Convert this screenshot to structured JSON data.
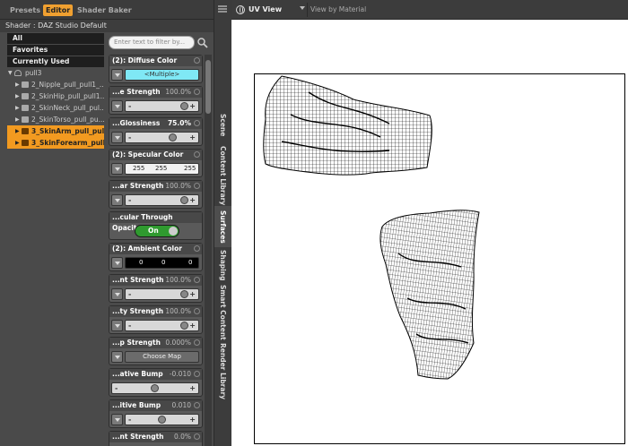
{
  "tabs": {
    "presets": "Presets",
    "editor": "Editor",
    "shader_baker": "Shader Baker"
  },
  "shader_label": "Shader : DAZ Studio Default",
  "categories": [
    "All",
    "Favorites",
    "Currently Used"
  ],
  "tree": {
    "root": "pull3",
    "items": [
      {
        "label": "2_Nipple_pull_pull1_...",
        "selected": false
      },
      {
        "label": "2_SkinHip_pull_pull1...",
        "selected": false
      },
      {
        "label": "2_SkinNeck_pull_pul...",
        "selected": false
      },
      {
        "label": "2_SkinTorso_pull_pu...",
        "selected": false
      },
      {
        "label": "3_SkinArm_pull_pull...",
        "selected": true
      },
      {
        "label": "3_SkinForearm_pull...",
        "selected": true
      }
    ]
  },
  "filter_placeholder": "Enter text to filter by...",
  "properties": {
    "diffuse_color": {
      "title": "(2): Diffuse Color",
      "value": "<Multiple>"
    },
    "diffuse_strength": {
      "title": "...e Strength",
      "value": "100.0%",
      "level": 1.0
    },
    "glossiness": {
      "title": "...Glossiness",
      "value": "75.0%",
      "level": 0.75
    },
    "specular_color": {
      "title": "(2): Specular Color",
      "r": "255",
      "g": "255",
      "b": "255"
    },
    "specular_strength": {
      "title": "...ar Strength",
      "value": "100.0%",
      "level": 1.0
    },
    "through_opacity": {
      "title": "...cular Through Opacity",
      "state": "On"
    },
    "ambient_color": {
      "title": "(2): Ambient Color",
      "r": "0",
      "g": "0",
      "b": "0"
    },
    "ambient_strength": {
      "title": "...nt Strength",
      "value": "100.0%",
      "level": 1.0
    },
    "opacity_strength": {
      "title": "...ty Strength",
      "value": "100.0%",
      "level": 1.0
    },
    "bump_strength": {
      "title": "...p Strength",
      "value": "0.000%",
      "button": "Choose Map"
    },
    "negative_bump": {
      "title": "...ative Bump",
      "value": "-0.010",
      "level": 0.5
    },
    "positive_bump": {
      "title": "...itive Bump",
      "value": "0.010",
      "level": 0.5
    },
    "last_strength": {
      "title": "...nt Strength",
      "value": "0.0%"
    }
  },
  "side_tabs": [
    "Scene",
    "Content Library",
    "Surfaces",
    "Shaping",
    "Smart Content",
    "Render Library"
  ],
  "active_side_tab": "Surfaces",
  "viewport": {
    "view_name": "UV View",
    "material_option": "View by Material"
  },
  "colors": {
    "accent": "#f29a20",
    "diffuse_swatch": "#7fe8f5",
    "toggle_on": "#2f9a2f"
  }
}
